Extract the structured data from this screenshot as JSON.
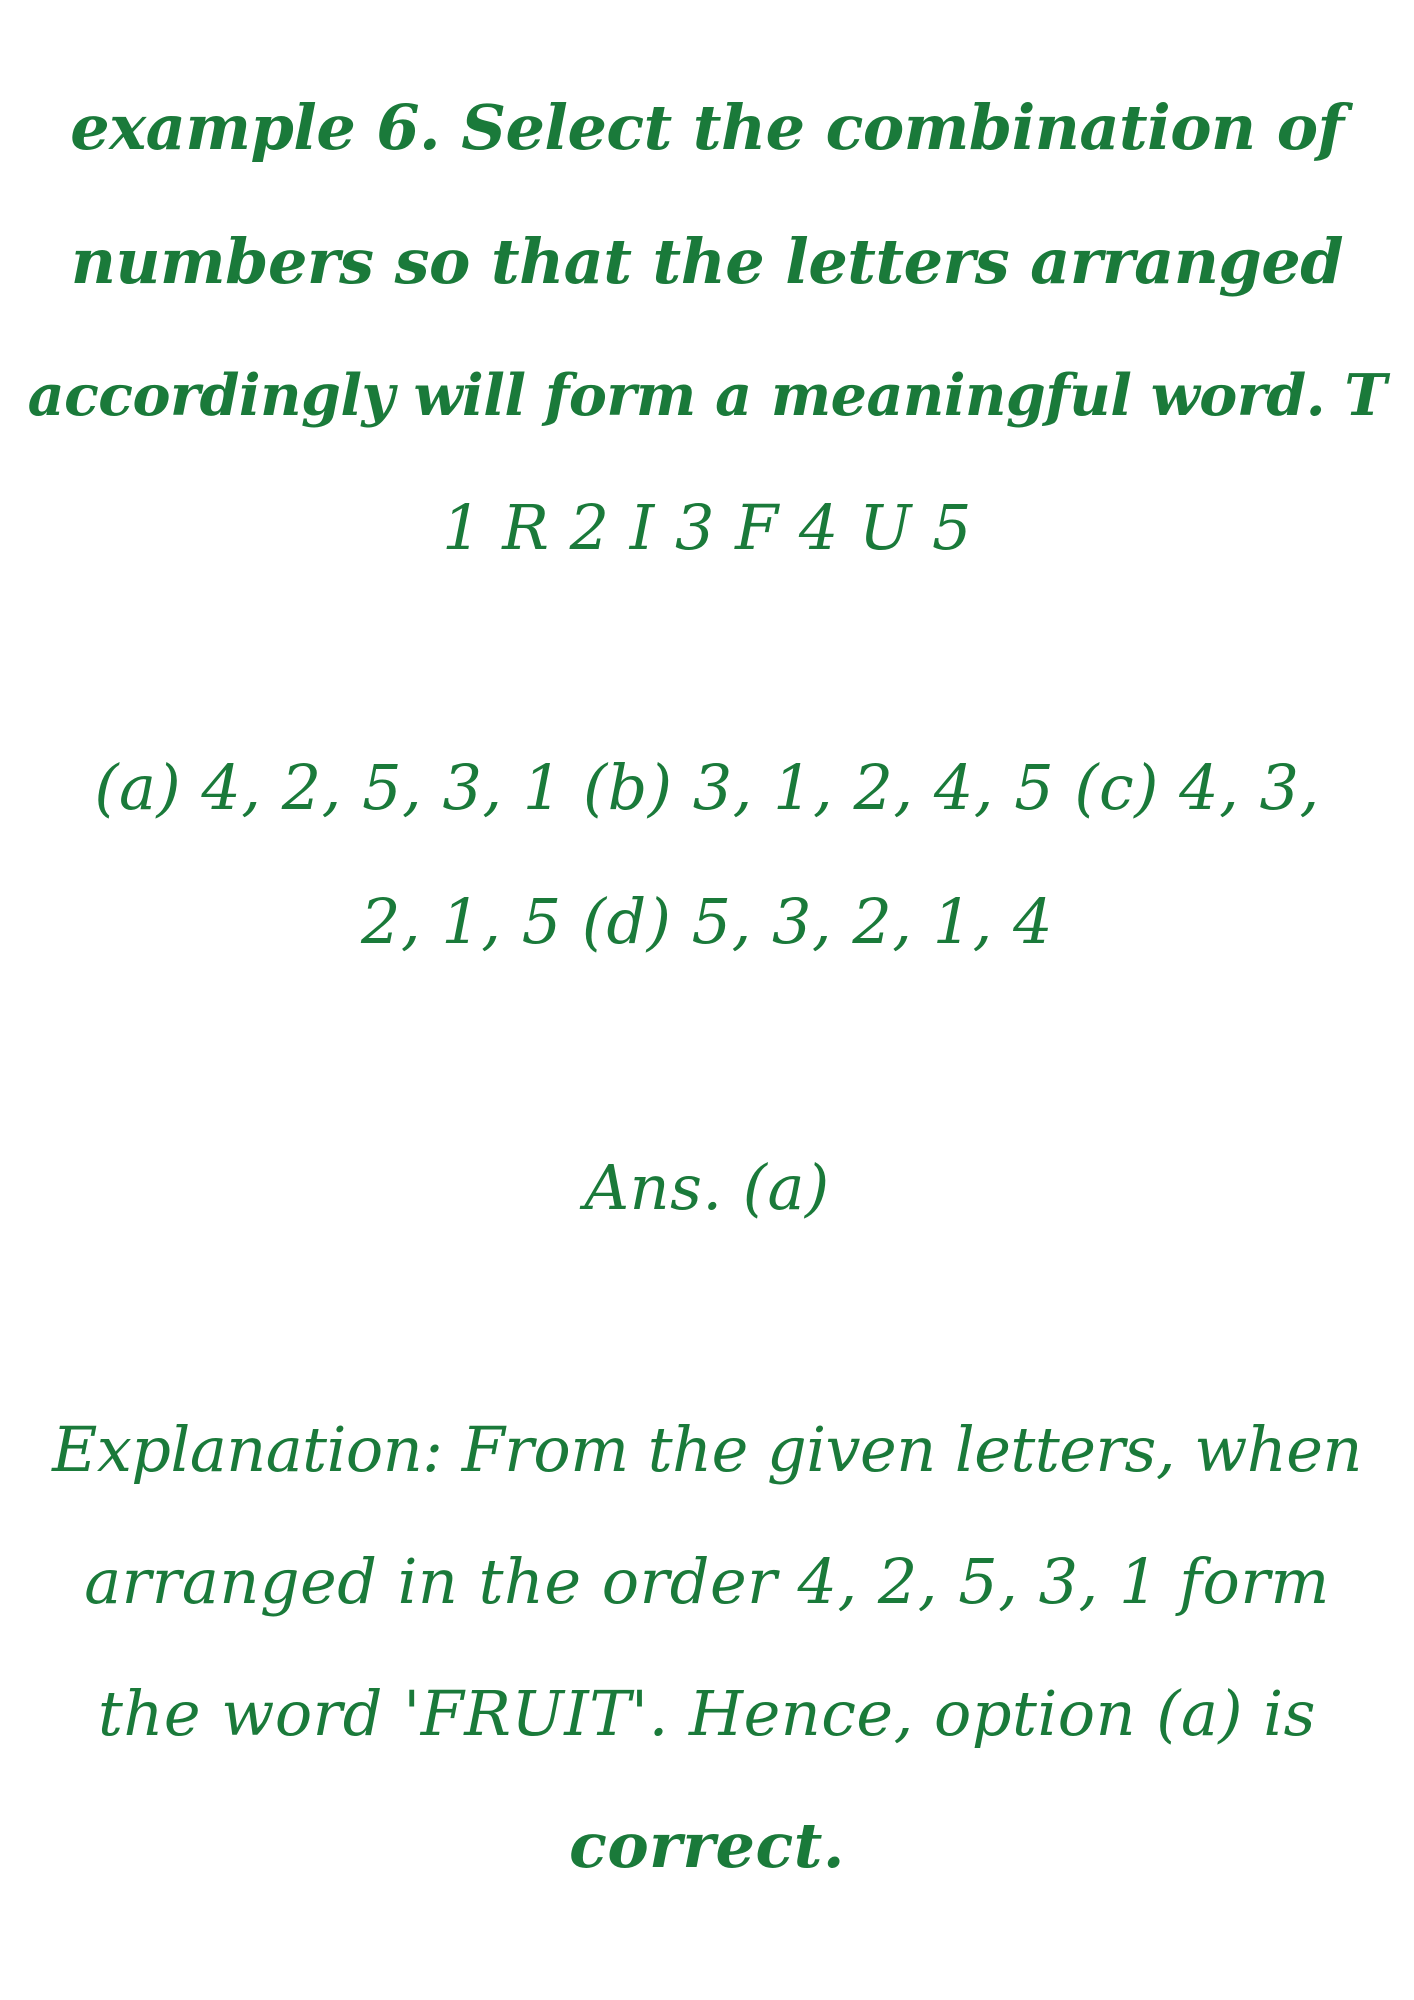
{
  "colors": {
    "text": "#1a7a3a",
    "background": "#ffffff"
  },
  "question": {
    "lines": [
      "example 6. Select the combination of",
      "numbers so that the letters arranged",
      "accordingly will form a meaningful word. T",
      "1 R 2 I 3 F 4 U 5"
    ]
  },
  "options": {
    "lines": [
      "(a) 4, 2, 5, 3, 1 (b) 3, 1, 2, 4, 5 (c) 4, 3,",
      "2, 1, 5 (d) 5, 3, 2, 1, 4"
    ]
  },
  "answer": {
    "text": "Ans. (a)"
  },
  "explanation": {
    "lines": [
      "Explanation: From the given letters, when",
      "arranged in the order 4, 2, 5, 3, 1 form",
      "the word 'FRUIT'. Hence, option (a) is",
      "correct."
    ]
  }
}
